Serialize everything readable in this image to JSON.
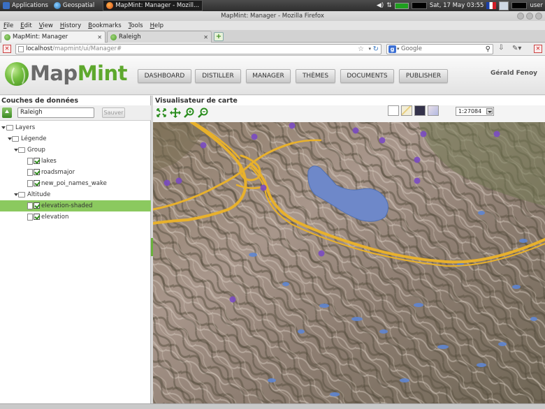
{
  "os_panel": {
    "applications": "Applications",
    "geospatial": "Geospatial",
    "firefox_task": "MapMint: Manager - Mozill...",
    "datetime": "Sat, 17 May  03:55",
    "user": "user"
  },
  "window": {
    "title": "MapMint: Manager - Mozilla Firefox"
  },
  "menu": {
    "items": [
      {
        "u": "F",
        "rest": "ile"
      },
      {
        "u": "E",
        "rest": "dit"
      },
      {
        "u": "V",
        "rest": "iew"
      },
      {
        "u": "H",
        "rest": "istory"
      },
      {
        "u": "B",
        "rest": "ookmarks"
      },
      {
        "u": "T",
        "rest": "ools"
      },
      {
        "u": "H",
        "rest": "elp"
      }
    ]
  },
  "tabs": [
    {
      "label": "MapMint: Manager"
    },
    {
      "label": "Raleigh"
    }
  ],
  "navbar": {
    "url_host": "localhost",
    "url_path": "/mapmint/ui/Manager#",
    "search_placeholder": "Google",
    "search_engine_badge": "g"
  },
  "app": {
    "logo_map": "Map",
    "logo_mint": "Mint",
    "nav": [
      "DASHBOARD",
      "DISTILLER",
      "MANAGER",
      "THÈMES",
      "DOCUMENTS",
      "PUBLISHER"
    ],
    "user_name": "Gérald Fenoy",
    "accent_color": "#5ea82d"
  },
  "left_panel": {
    "title": "Couches de données",
    "map_name_value": "Raleigh",
    "save_label": "Sauver",
    "tree": {
      "root": "Layers",
      "legend": "Légende",
      "group": "Group",
      "group_layers": [
        "lakes",
        "roadsmajor",
        "new_poi_names_wake"
      ],
      "altitude": "Altitude",
      "altitude_layers": [
        "elevation-shaded",
        "elevation"
      ]
    },
    "selected_layer": "elevation-shaded"
  },
  "map_panel": {
    "title": "Visualisateur de carte",
    "scale": "1:27084"
  }
}
